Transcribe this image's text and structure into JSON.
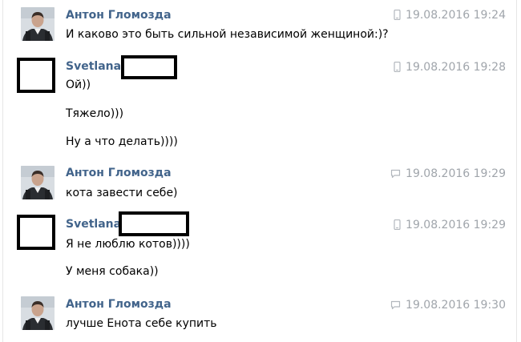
{
  "messages": [
    {
      "author": "Антон Гломозда",
      "time": "19.08.2016 19:24",
      "device_icon": "mobile-phone-icon",
      "lines": [
        "И каково это быть сильной независимой женщиной:)?"
      ]
    },
    {
      "author": "Svetlana",
      "time": "19.08.2016 19:28",
      "device_icon": "mobile-phone-icon",
      "lines": [
        "Ой))",
        "Тяжело)))",
        "Ну а что делать))))"
      ]
    },
    {
      "author": "Антон Гломозда",
      "time": "19.08.2016 19:29",
      "device_icon": "speech-bubble-icon",
      "lines": [
        "кота завести себе)"
      ]
    },
    {
      "author": "Svetlana",
      "time": "19.08.2016 19:29",
      "device_icon": "mobile-phone-icon",
      "lines": [
        "Я не люблю котов))))",
        "У меня собака))"
      ]
    },
    {
      "author": "Антон Гломозда",
      "time": "19.08.2016 19:30",
      "device_icon": "speech-bubble-icon",
      "lines": [
        "лучше Енота себе купить"
      ]
    }
  ],
  "colors": {
    "author": "#42648b",
    "time": "#a0a5ab",
    "text": "#000000"
  }
}
